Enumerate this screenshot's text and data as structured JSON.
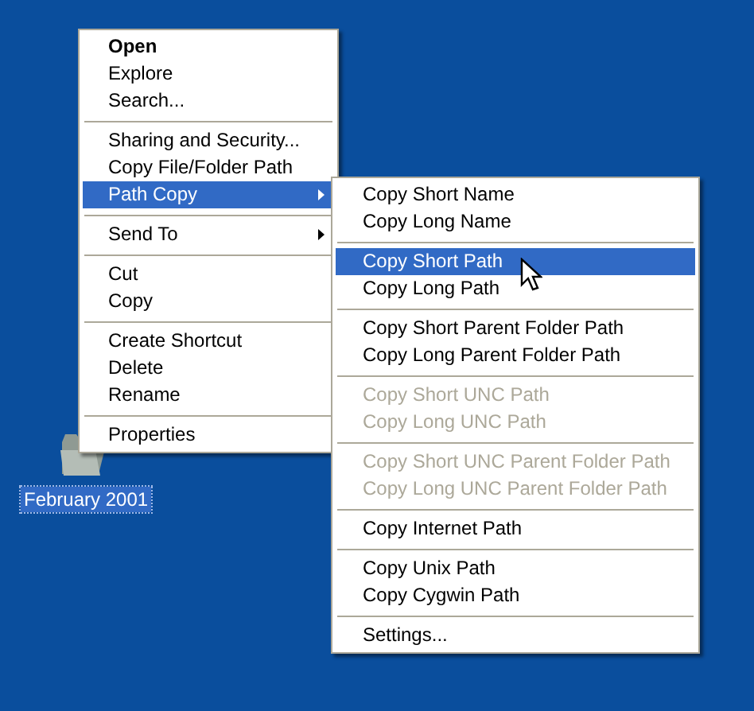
{
  "desktop_icon": {
    "label": "February 2001",
    "selected": true
  },
  "context_menu": {
    "sections": [
      {
        "items": [
          {
            "label": "Open",
            "default": true,
            "selected": false,
            "disabled": false,
            "submenu": false
          },
          {
            "label": "Explore",
            "default": false,
            "selected": false,
            "disabled": false,
            "submenu": false
          },
          {
            "label": "Search...",
            "default": false,
            "selected": false,
            "disabled": false,
            "submenu": false
          }
        ]
      },
      {
        "items": [
          {
            "label": "Sharing and Security...",
            "default": false,
            "selected": false,
            "disabled": false,
            "submenu": false
          },
          {
            "label": "Copy File/Folder Path",
            "default": false,
            "selected": false,
            "disabled": false,
            "submenu": false
          },
          {
            "label": "Path Copy",
            "default": false,
            "selected": true,
            "disabled": false,
            "submenu": true
          }
        ]
      },
      {
        "items": [
          {
            "label": "Send To",
            "default": false,
            "selected": false,
            "disabled": false,
            "submenu": true
          }
        ]
      },
      {
        "items": [
          {
            "label": "Cut",
            "default": false,
            "selected": false,
            "disabled": false,
            "submenu": false
          },
          {
            "label": "Copy",
            "default": false,
            "selected": false,
            "disabled": false,
            "submenu": false
          }
        ]
      },
      {
        "items": [
          {
            "label": "Create Shortcut",
            "default": false,
            "selected": false,
            "disabled": false,
            "submenu": false
          },
          {
            "label": "Delete",
            "default": false,
            "selected": false,
            "disabled": false,
            "submenu": false
          },
          {
            "label": "Rename",
            "default": false,
            "selected": false,
            "disabled": false,
            "submenu": false
          }
        ]
      },
      {
        "items": [
          {
            "label": "Properties",
            "default": false,
            "selected": false,
            "disabled": false,
            "submenu": false
          }
        ]
      }
    ]
  },
  "submenu": {
    "sections": [
      {
        "items": [
          {
            "label": "Copy Short Name",
            "default": false,
            "selected": false,
            "disabled": false,
            "submenu": false
          },
          {
            "label": "Copy Long Name",
            "default": false,
            "selected": false,
            "disabled": false,
            "submenu": false
          }
        ]
      },
      {
        "items": [
          {
            "label": "Copy Short Path",
            "default": false,
            "selected": true,
            "disabled": false,
            "submenu": false
          },
          {
            "label": "Copy Long Path",
            "default": false,
            "selected": false,
            "disabled": false,
            "submenu": false
          }
        ]
      },
      {
        "items": [
          {
            "label": "Copy Short Parent Folder Path",
            "default": false,
            "selected": false,
            "disabled": false,
            "submenu": false
          },
          {
            "label": "Copy Long Parent Folder Path",
            "default": false,
            "selected": false,
            "disabled": false,
            "submenu": false
          }
        ]
      },
      {
        "items": [
          {
            "label": "Copy Short UNC Path",
            "default": false,
            "selected": false,
            "disabled": true,
            "submenu": false
          },
          {
            "label": "Copy Long UNC Path",
            "default": false,
            "selected": false,
            "disabled": true,
            "submenu": false
          }
        ]
      },
      {
        "items": [
          {
            "label": "Copy Short UNC Parent Folder Path",
            "default": false,
            "selected": false,
            "disabled": true,
            "submenu": false
          },
          {
            "label": "Copy Long UNC Parent Folder Path",
            "default": false,
            "selected": false,
            "disabled": true,
            "submenu": false
          }
        ]
      },
      {
        "items": [
          {
            "label": "Copy Internet Path",
            "default": false,
            "selected": false,
            "disabled": false,
            "submenu": false
          }
        ]
      },
      {
        "items": [
          {
            "label": "Copy Unix Path",
            "default": false,
            "selected": false,
            "disabled": false,
            "submenu": false
          },
          {
            "label": "Copy Cygwin Path",
            "default": false,
            "selected": false,
            "disabled": false,
            "submenu": false
          }
        ]
      },
      {
        "items": [
          {
            "label": "Settings...",
            "default": false,
            "selected": false,
            "disabled": false,
            "submenu": false
          }
        ]
      }
    ]
  }
}
